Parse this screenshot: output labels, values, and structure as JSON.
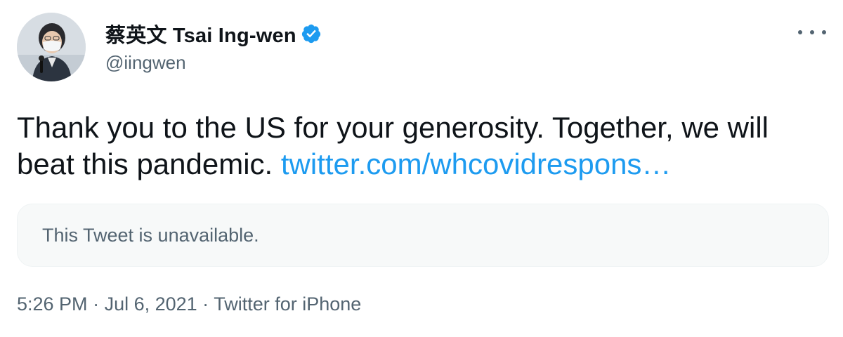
{
  "tweet": {
    "author": {
      "display_name": "蔡英文 Tsai Ing-wen",
      "handle": "@iingwen",
      "verified_icon": "verified-badge-icon",
      "avatar_icon": "avatar-photo"
    },
    "more_icon": "more-horizontal-icon",
    "text_prefix": "Thank you to the US for your generosity. Together, we will beat this pandemic. ",
    "link_text": "twitter.com/whcovidrespons…",
    "quote_card": {
      "text": "This Tweet is unavailable."
    },
    "meta": {
      "time": "5:26 PM",
      "separator": " · ",
      "date": "Jul 6, 2021",
      "source": "Twitter for iPhone"
    }
  },
  "colors": {
    "link": "#1d9bf0",
    "secondary_text": "#536471",
    "primary_text": "#0f1419",
    "card_background": "#f7f9f9",
    "verified": "#1d9bf0"
  }
}
